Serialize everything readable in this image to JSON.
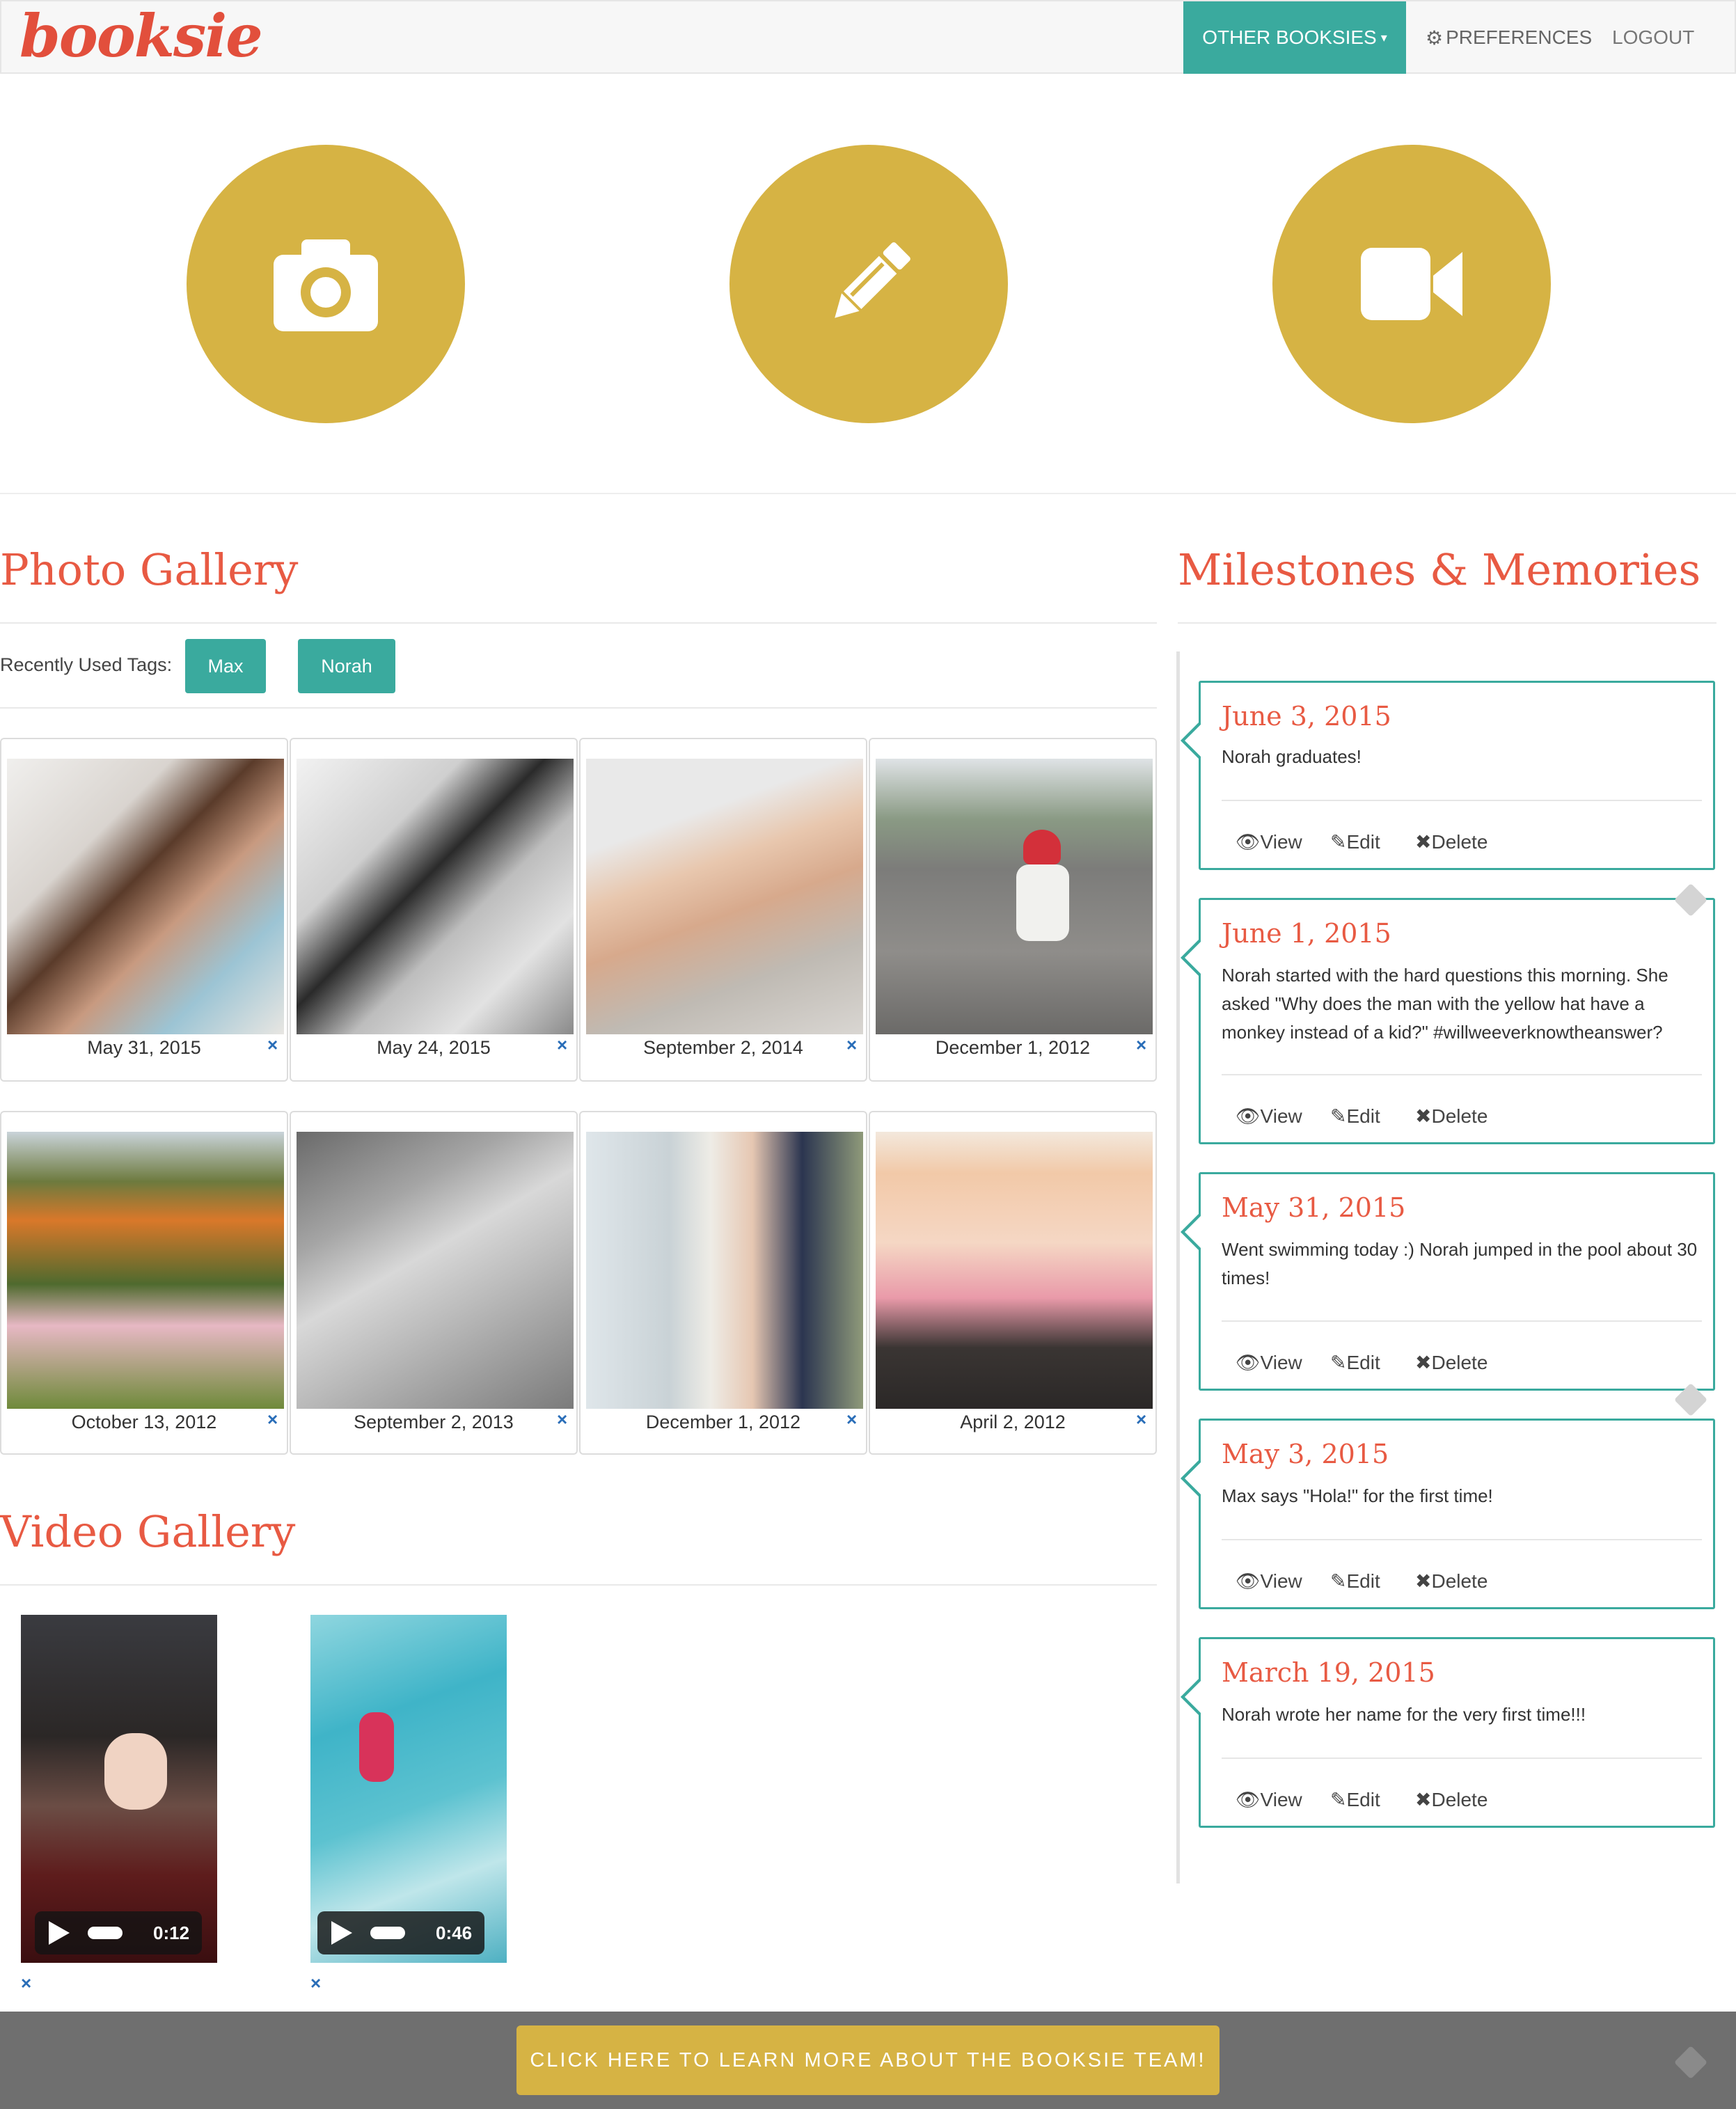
{
  "navbar": {
    "logo": "booksie",
    "other_booksies": "OTHER BOOKSIES",
    "preferences": "PREFERENCES",
    "logout": "LOGOUT"
  },
  "actions": [
    {
      "icon": "camera-icon"
    },
    {
      "icon": "pencil-icon"
    },
    {
      "icon": "video-camera-icon"
    }
  ],
  "photo_gallery": {
    "title": "Photo Gallery",
    "tags_label": "Recently Used Tags:",
    "tags": [
      "Max",
      "Norah"
    ],
    "photos": [
      {
        "date": "May 31, 2015"
      },
      {
        "date": "May 24, 2015"
      },
      {
        "date": "September 2, 2014"
      },
      {
        "date": "December 1, 2012"
      },
      {
        "date": "October 13, 2012"
      },
      {
        "date": "September 2, 2013"
      },
      {
        "date": "December 1, 2012"
      },
      {
        "date": "April 2, 2012"
      }
    ],
    "remove_icon": "×"
  },
  "video_gallery": {
    "title": "Video Gallery",
    "videos": [
      {
        "duration": "0:12"
      },
      {
        "duration": "0:46"
      }
    ]
  },
  "milestones": {
    "title": "Milestones & Memories",
    "actions": {
      "view": "View",
      "edit": "Edit",
      "delete": "Delete"
    },
    "items": [
      {
        "date": "June 3, 2015",
        "text": "Norah graduates!"
      },
      {
        "date": "June 1, 2015",
        "text": "Norah started with the hard questions this morning. She asked \"Why does the man with the yellow hat have a monkey instead of a kid?\" #willweeverknowtheanswer?"
      },
      {
        "date": "May 31, 2015",
        "text": "Went swimming today :) Norah jumped in the pool about 30 times!"
      },
      {
        "date": "May 3, 2015",
        "text": "Max says \"Hola!\" for the first time!"
      },
      {
        "date": "March 19, 2015",
        "text": "Norah wrote her name for the very first time!!!"
      }
    ]
  },
  "footer": {
    "cta": "CLICK HERE TO LEARN MORE ABOUT THE BOOKSIE TEAM!"
  },
  "colors": {
    "accent_teal": "#3aaa9e",
    "accent_gold": "#d6b344",
    "heading_red": "#e85a43"
  }
}
